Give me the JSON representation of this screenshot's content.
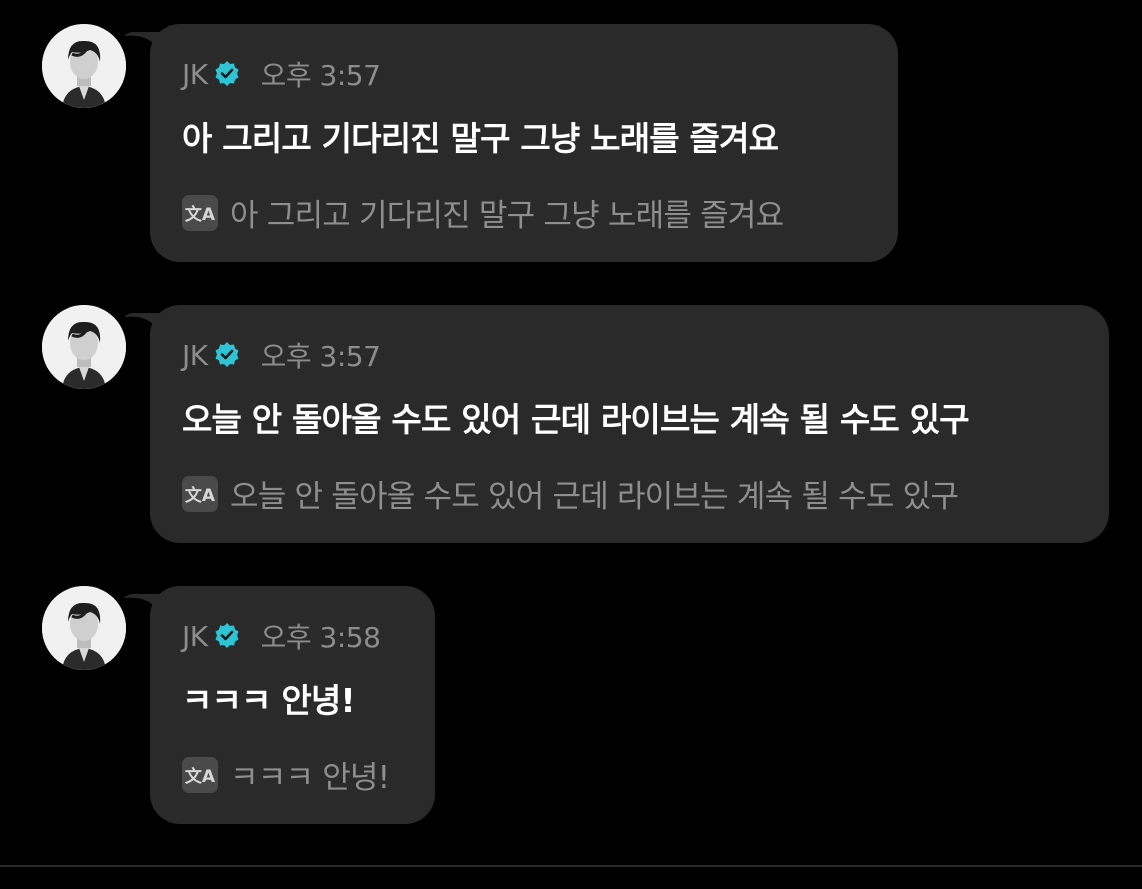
{
  "colors": {
    "background": "#000000",
    "bubble": "#2a2a2a",
    "verified_badge": "#2ec4d6",
    "meta_text": "#8c8c8c",
    "message_text": "#ffffff"
  },
  "messages": [
    {
      "avatar": "profile-photo",
      "sender": "JK",
      "verified_icon": "verified-badge-icon",
      "time": "오후 3:57",
      "text": "아 그리고 기다리진 말구 그냥 노래를 즐겨요",
      "translate_icon": "translate-icon",
      "translation": "아 그리고 기다리진 말구 그냥 노래를 즐겨요"
    },
    {
      "avatar": "profile-photo",
      "sender": "JK",
      "verified_icon": "verified-badge-icon",
      "time": "오후 3:57",
      "text": "오늘 안 돌아올 수도 있어 근데 라이브는 계속 될 수도 있구",
      "translate_icon": "translate-icon",
      "translation": "오늘 안 돌아올 수도 있어 근데 라이브는 계속 될 수도 있구"
    },
    {
      "avatar": "profile-photo",
      "sender": "JK",
      "verified_icon": "verified-badge-icon",
      "time": "오후 3:58",
      "text": "ㅋㅋㅋ 안녕!",
      "translate_icon": "translate-icon",
      "translation": "ㅋㅋㅋ 안녕!"
    }
  ]
}
